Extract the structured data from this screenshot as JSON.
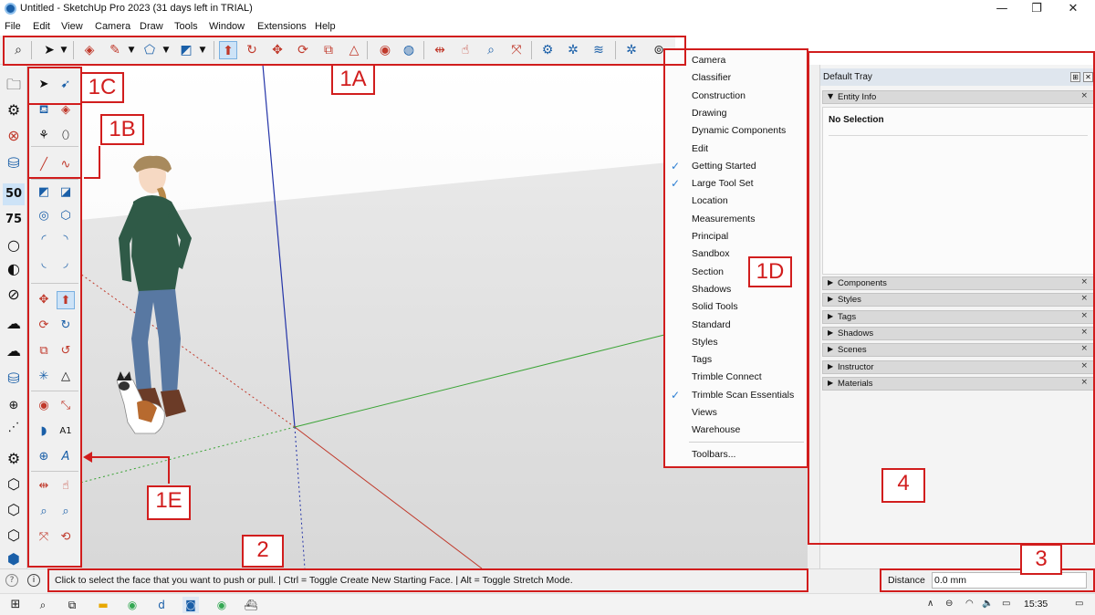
{
  "window": {
    "title": "Untitled - SketchUp Pro 2023 (31 days left in TRIAL)",
    "controls": [
      "—",
      "❐",
      "✕"
    ]
  },
  "menubar": [
    "File",
    "Edit",
    "View",
    "Camera",
    "Draw",
    "Tools",
    "Window",
    "Extensions",
    "Help"
  ],
  "toolbars_menu": {
    "items": [
      {
        "label": "Camera",
        "checked": false
      },
      {
        "label": "Classifier",
        "checked": false
      },
      {
        "label": "Construction",
        "checked": false
      },
      {
        "label": "Drawing",
        "checked": false
      },
      {
        "label": "Dynamic Components",
        "checked": false
      },
      {
        "label": "Edit",
        "checked": false
      },
      {
        "label": "Getting Started",
        "checked": true
      },
      {
        "label": "Large Tool Set",
        "checked": true
      },
      {
        "label": "Location",
        "checked": false
      },
      {
        "label": "Measurements",
        "checked": false
      },
      {
        "label": "Principal",
        "checked": false
      },
      {
        "label": "Sandbox",
        "checked": false
      },
      {
        "label": "Section",
        "checked": false
      },
      {
        "label": "Shadows",
        "checked": false
      },
      {
        "label": "Solid Tools",
        "checked": false
      },
      {
        "label": "Standard",
        "checked": false
      },
      {
        "label": "Styles",
        "checked": false
      },
      {
        "label": "Tags",
        "checked": false
      },
      {
        "label": "Trimble Connect",
        "checked": false
      },
      {
        "label": "Trimble Scan Essentials",
        "checked": true
      },
      {
        "label": "Views",
        "checked": false
      },
      {
        "label": "Warehouse",
        "checked": false
      }
    ],
    "footer": "Toolbars..."
  },
  "tray": {
    "title": "Default Tray",
    "entity_info": {
      "label": "Entity Info",
      "selection": "No Selection"
    },
    "panels": [
      "Components",
      "Styles",
      "Tags",
      "Shadows",
      "Scenes",
      "Instructor",
      "Materials"
    ]
  },
  "status": {
    "message": "Click to select the face that you want to push or pull. | Ctrl = Toggle Create New Starting Face. | Alt = Toggle Stretch Mode.",
    "measure_label": "Distance",
    "measure_value": "0.0 mm"
  },
  "taskbar": {
    "clock": "15:35"
  },
  "annotations": {
    "1A": "1A",
    "1B": "1B",
    "1C": "1C",
    "1D": "1D",
    "1E": "1E",
    "2": "2",
    "3": "3",
    "4": "4"
  },
  "colors": {
    "annotation_red": "#d11d1d",
    "checkmark_blue": "#2d7fd3",
    "axis_green": "#3aa335",
    "axis_red": "#c0392b",
    "axis_blue": "#2434a8"
  },
  "toolbar_icons": [
    "search-icon",
    "select-icon",
    "eraser-icon",
    "pencil-icon",
    "shape-icon",
    "rectangle-icon",
    "push-pull-icon",
    "follow-me-icon",
    "move-icon",
    "rotate-icon",
    "scale-icon",
    "offset-icon",
    "position-camera-icon",
    "walk-icon",
    "section-plane-icon",
    "look-around-icon",
    "zoom-icon",
    "zoom-extents-icon",
    "warehouse-icon",
    "extension-warehouse-icon",
    "layout-icon",
    "trimble-connect-icon",
    "scan-essentials-icon"
  ],
  "left_column_icons": [
    "folder-icon",
    "gear-icon",
    "close-circle-icon",
    "scan-icon",
    "scan-50-icon",
    "scan-75-icon",
    "outline-drop-icon",
    "contrast-icon",
    "stripes-icon",
    "cloud-x-icon",
    "cloud-down-icon",
    "scan-stack-icon",
    "add-point-icon",
    "line-icon",
    "gear-scan-icon",
    "hexagon-scan-icon",
    "hexagon-scan-2-icon",
    "hexagon-cloud-icon",
    "hexagon-cube-icon",
    "hexagon-end-icon"
  ]
}
